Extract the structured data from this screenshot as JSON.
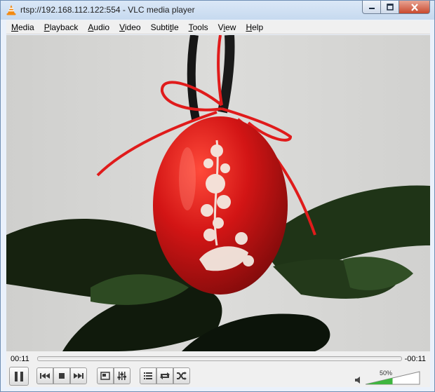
{
  "window": {
    "title": "rtsp://192.168.112.122:554 - VLC media player"
  },
  "menu": [
    {
      "pre": "",
      "u": "M",
      "post": "edia"
    },
    {
      "pre": "",
      "u": "P",
      "post": "layback"
    },
    {
      "pre": "",
      "u": "A",
      "post": "udio"
    },
    {
      "pre": "",
      "u": "V",
      "post": "ideo"
    },
    {
      "pre": "Subti",
      "u": "t",
      "post": "le"
    },
    {
      "pre": "",
      "u": "T",
      "post": "ools"
    },
    {
      "pre": "V",
      "u": "i",
      "post": "ew"
    },
    {
      "pre": "",
      "u": "H",
      "post": "elp"
    }
  ],
  "playback": {
    "elapsed": "00:11",
    "remaining": "-00:11",
    "progress_fraction": 0.0
  },
  "volume": {
    "label": "50%",
    "level_fraction": 0.5
  },
  "icons": {
    "app": "vlc-cone-icon",
    "pause": "pause-icon",
    "previous": "previous-icon",
    "stop": "stop-icon",
    "next": "next-icon",
    "fullscreen": "fullscreen-icon",
    "extended": "extended-settings-icon",
    "playlist": "playlist-icon",
    "loop": "loop-icon",
    "shuffle": "shuffle-icon",
    "speaker": "speaker-icon"
  },
  "colors": {
    "egg": "#d11414",
    "ribbon": "#e21a1a",
    "leaf": "#1d2b1a",
    "background": "#d6d6d4",
    "volume_fill": "#3fb53f"
  }
}
